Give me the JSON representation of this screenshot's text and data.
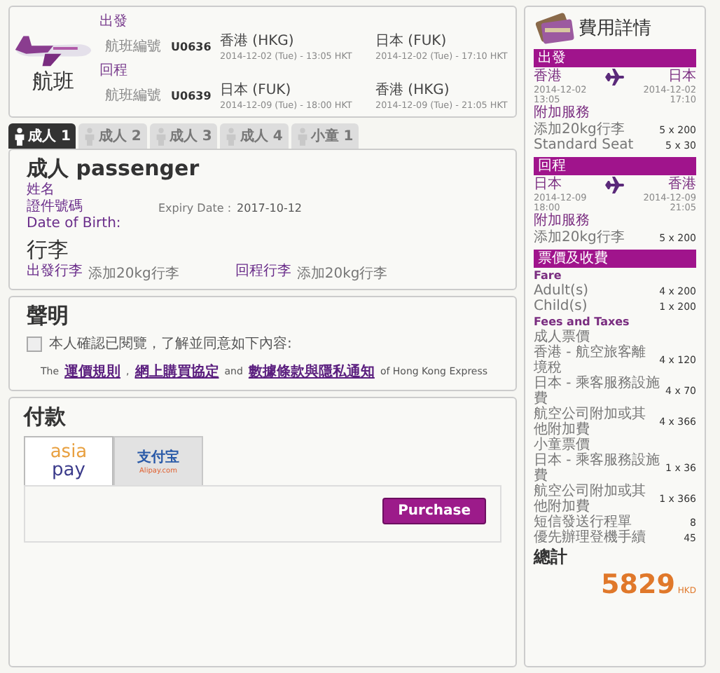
{
  "flights": {
    "title": "航班",
    "legs": [
      {
        "label": "出發",
        "number_label": "航班編號",
        "number": "U0636",
        "from": {
          "place": "香港 (HKG)",
          "time": "2014-12-02 (Tue) - 13:05 HKT"
        },
        "to": {
          "place": "日本 (FUK)",
          "time": "2014-12-02 (Tue) - 17:10 HKT"
        }
      },
      {
        "label": "回程",
        "number_label": "航班編號",
        "number": "U0639",
        "from": {
          "place": "日本 (FUK)",
          "time": "2014-12-09 (Tue) - 18:00 HKT"
        },
        "to": {
          "place": "香港 (HKG)",
          "time": "2014-12-09 (Tue) - 21:05 HKT"
        }
      }
    ]
  },
  "passenger_tabs": [
    {
      "label": "成人 1",
      "selected": true
    },
    {
      "label": "成人 2",
      "selected": false
    },
    {
      "label": "成人 3",
      "selected": false
    },
    {
      "label": "成人 4",
      "selected": false
    },
    {
      "label": "小童 1",
      "selected": false
    }
  ],
  "passenger": {
    "title": "成人 passenger",
    "name_label": "姓名",
    "document_label": "證件號碼",
    "expiry_label": "Expiry Date :",
    "expiry": "2017-10-12",
    "birth_label": "Date of Birth:",
    "baggage_title": "行李",
    "baggage": [
      {
        "label": "出發行李",
        "value": "添加20kg行李"
      },
      {
        "label": "回程行李",
        "value": "添加20kg行李"
      }
    ]
  },
  "declaration": {
    "title": "聲明",
    "checkbox": {
      "label": "本人確認已閱覽，了解並同意如下內容:",
      "checked": false
    },
    "parts": [
      {
        "kind": "text",
        "text": "The"
      },
      {
        "kind": "link",
        "text": "運價規則"
      },
      {
        "kind": "text",
        "text": ","
      },
      {
        "kind": "link",
        "text": "網上購買協定"
      },
      {
        "kind": "text",
        "text": "and"
      },
      {
        "kind": "link",
        "text": "數據條款與隱私通知"
      },
      {
        "kind": "text",
        "text": "of Hong Kong Express"
      }
    ]
  },
  "payment": {
    "title": "付款",
    "methods": [
      {
        "kind": "asiapay",
        "top": "asia",
        "bottom": "pay",
        "selected": true
      },
      {
        "kind": "alipay",
        "top": "支付宝",
        "bottom": "Alipay.com",
        "selected": false
      }
    ],
    "button": "Purchase"
  },
  "summary": {
    "title": "費用詳情",
    "legs": [
      {
        "header": "出發",
        "from": "香港",
        "to": "日本",
        "from_date": "2014-12-02",
        "from_time": "13:05",
        "to_date": "2014-12-02",
        "to_time": "17:10",
        "extras_title": "附加服務",
        "extras": [
          {
            "label": "添加20kg行李",
            "value": "5 x 200"
          },
          {
            "label": "Standard Seat",
            "value": "5 x 30"
          }
        ]
      },
      {
        "header": "回程",
        "from": "日本",
        "to": "香港",
        "from_date": "2014-12-09",
        "from_time": "18:00",
        "to_date": "2014-12-09",
        "to_time": "21:05",
        "extras_title": "附加服務",
        "extras": [
          {
            "label": "添加20kg行李",
            "value": "5 x 200"
          }
        ]
      }
    ],
    "fees_header": "票價及收費",
    "fees": [
      {
        "kind": "heading",
        "label": "Fare"
      },
      {
        "kind": "fee",
        "label": "Adult(s)",
        "value": "4 x 200"
      },
      {
        "kind": "fee",
        "label": "Child(s)",
        "value": "1 x 200"
      },
      {
        "kind": "heading",
        "label": "Fees and Taxes"
      },
      {
        "kind": "group",
        "label": "成人票價"
      },
      {
        "kind": "fee",
        "label": "香港 - 航空旅客離境稅",
        "value": "4 x 120"
      },
      {
        "kind": "fee",
        "label": "日本 - 乘客服務設施費",
        "value": "4 x 70"
      },
      {
        "kind": "fee",
        "label": "航空公司附加或其他附加費",
        "value": "4 x 366"
      },
      {
        "kind": "group",
        "label": "小童票價"
      },
      {
        "kind": "fee",
        "label": "日本 - 乘客服務設施費",
        "value": "1 x 36"
      },
      {
        "kind": "fee",
        "label": "航空公司附加或其他附加費",
        "value": "1 x 366"
      },
      {
        "kind": "fee",
        "label": "短信發送行程單",
        "value": "8"
      },
      {
        "kind": "fee",
        "label": "優先辦理登機手續",
        "value": "45"
      }
    ],
    "total_label": "總計",
    "total": "5829",
    "currency": "HKD"
  }
}
